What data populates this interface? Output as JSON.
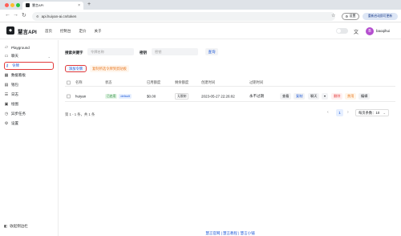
{
  "browser": {
    "tab_title": "慧言API",
    "url": "api.huiyan-ai.cn/token",
    "settings_label": "设置",
    "restart_label": "重新启动即可更新",
    "traffic_colors": [
      "#ff5f57",
      "#febc2e",
      "#28c840"
    ]
  },
  "app": {
    "name": "慧言API",
    "nav": [
      "首页",
      "控制台",
      "定价",
      "关于"
    ],
    "username": "baoqihui",
    "avatar_letter": "B"
  },
  "sidebar": {
    "items": [
      {
        "label": "Playground",
        "icon": "playground-icon"
      },
      {
        "label": "聊天",
        "icon": "chat-icon"
      },
      {
        "label": "令牌",
        "icon": "key-icon"
      },
      {
        "label": "数据看板",
        "icon": "dashboard-icon"
      },
      {
        "label": "钱包",
        "icon": "wallet-icon"
      },
      {
        "label": "日志",
        "icon": "log-icon"
      },
      {
        "label": "绘图",
        "icon": "image-icon"
      },
      {
        "label": "异步任务",
        "icon": "task-icon"
      },
      {
        "label": "设置",
        "icon": "settings-icon"
      }
    ],
    "collapse_label": "收起侧边栏"
  },
  "filters": {
    "keyword_label": "搜索关键字",
    "keyword_placeholder": "令牌名称",
    "key_label": "密钥",
    "key_placeholder": "密钥",
    "query_label": "查询"
  },
  "actions": {
    "add_label": "添加令牌",
    "copy_label": "复制所选令牌到剪贴板"
  },
  "table": {
    "headers": [
      "名称",
      "状态",
      "已用额度",
      "剩余额度",
      "创建时间",
      "过期时间"
    ],
    "rows": [
      {
        "name": "huiyan",
        "status": "已启用",
        "group": "default",
        "used": "$0.00",
        "remaining": "无限制",
        "created": "2023-05-27 22:26:02",
        "expires": "永不过期",
        "btn_view": "查看",
        "btn_copy": "复制",
        "btn_chat": "聊天",
        "btn_delete": "删除",
        "btn_disable": "禁用",
        "btn_edit": "编辑"
      }
    ]
  },
  "pagination": {
    "info": "第 1 - 1 条，共 1 条",
    "current_page": "1",
    "page_size": "每页条数：10"
  },
  "footer": "慧言官网 | 慧言教程 | 慧言小铺"
}
